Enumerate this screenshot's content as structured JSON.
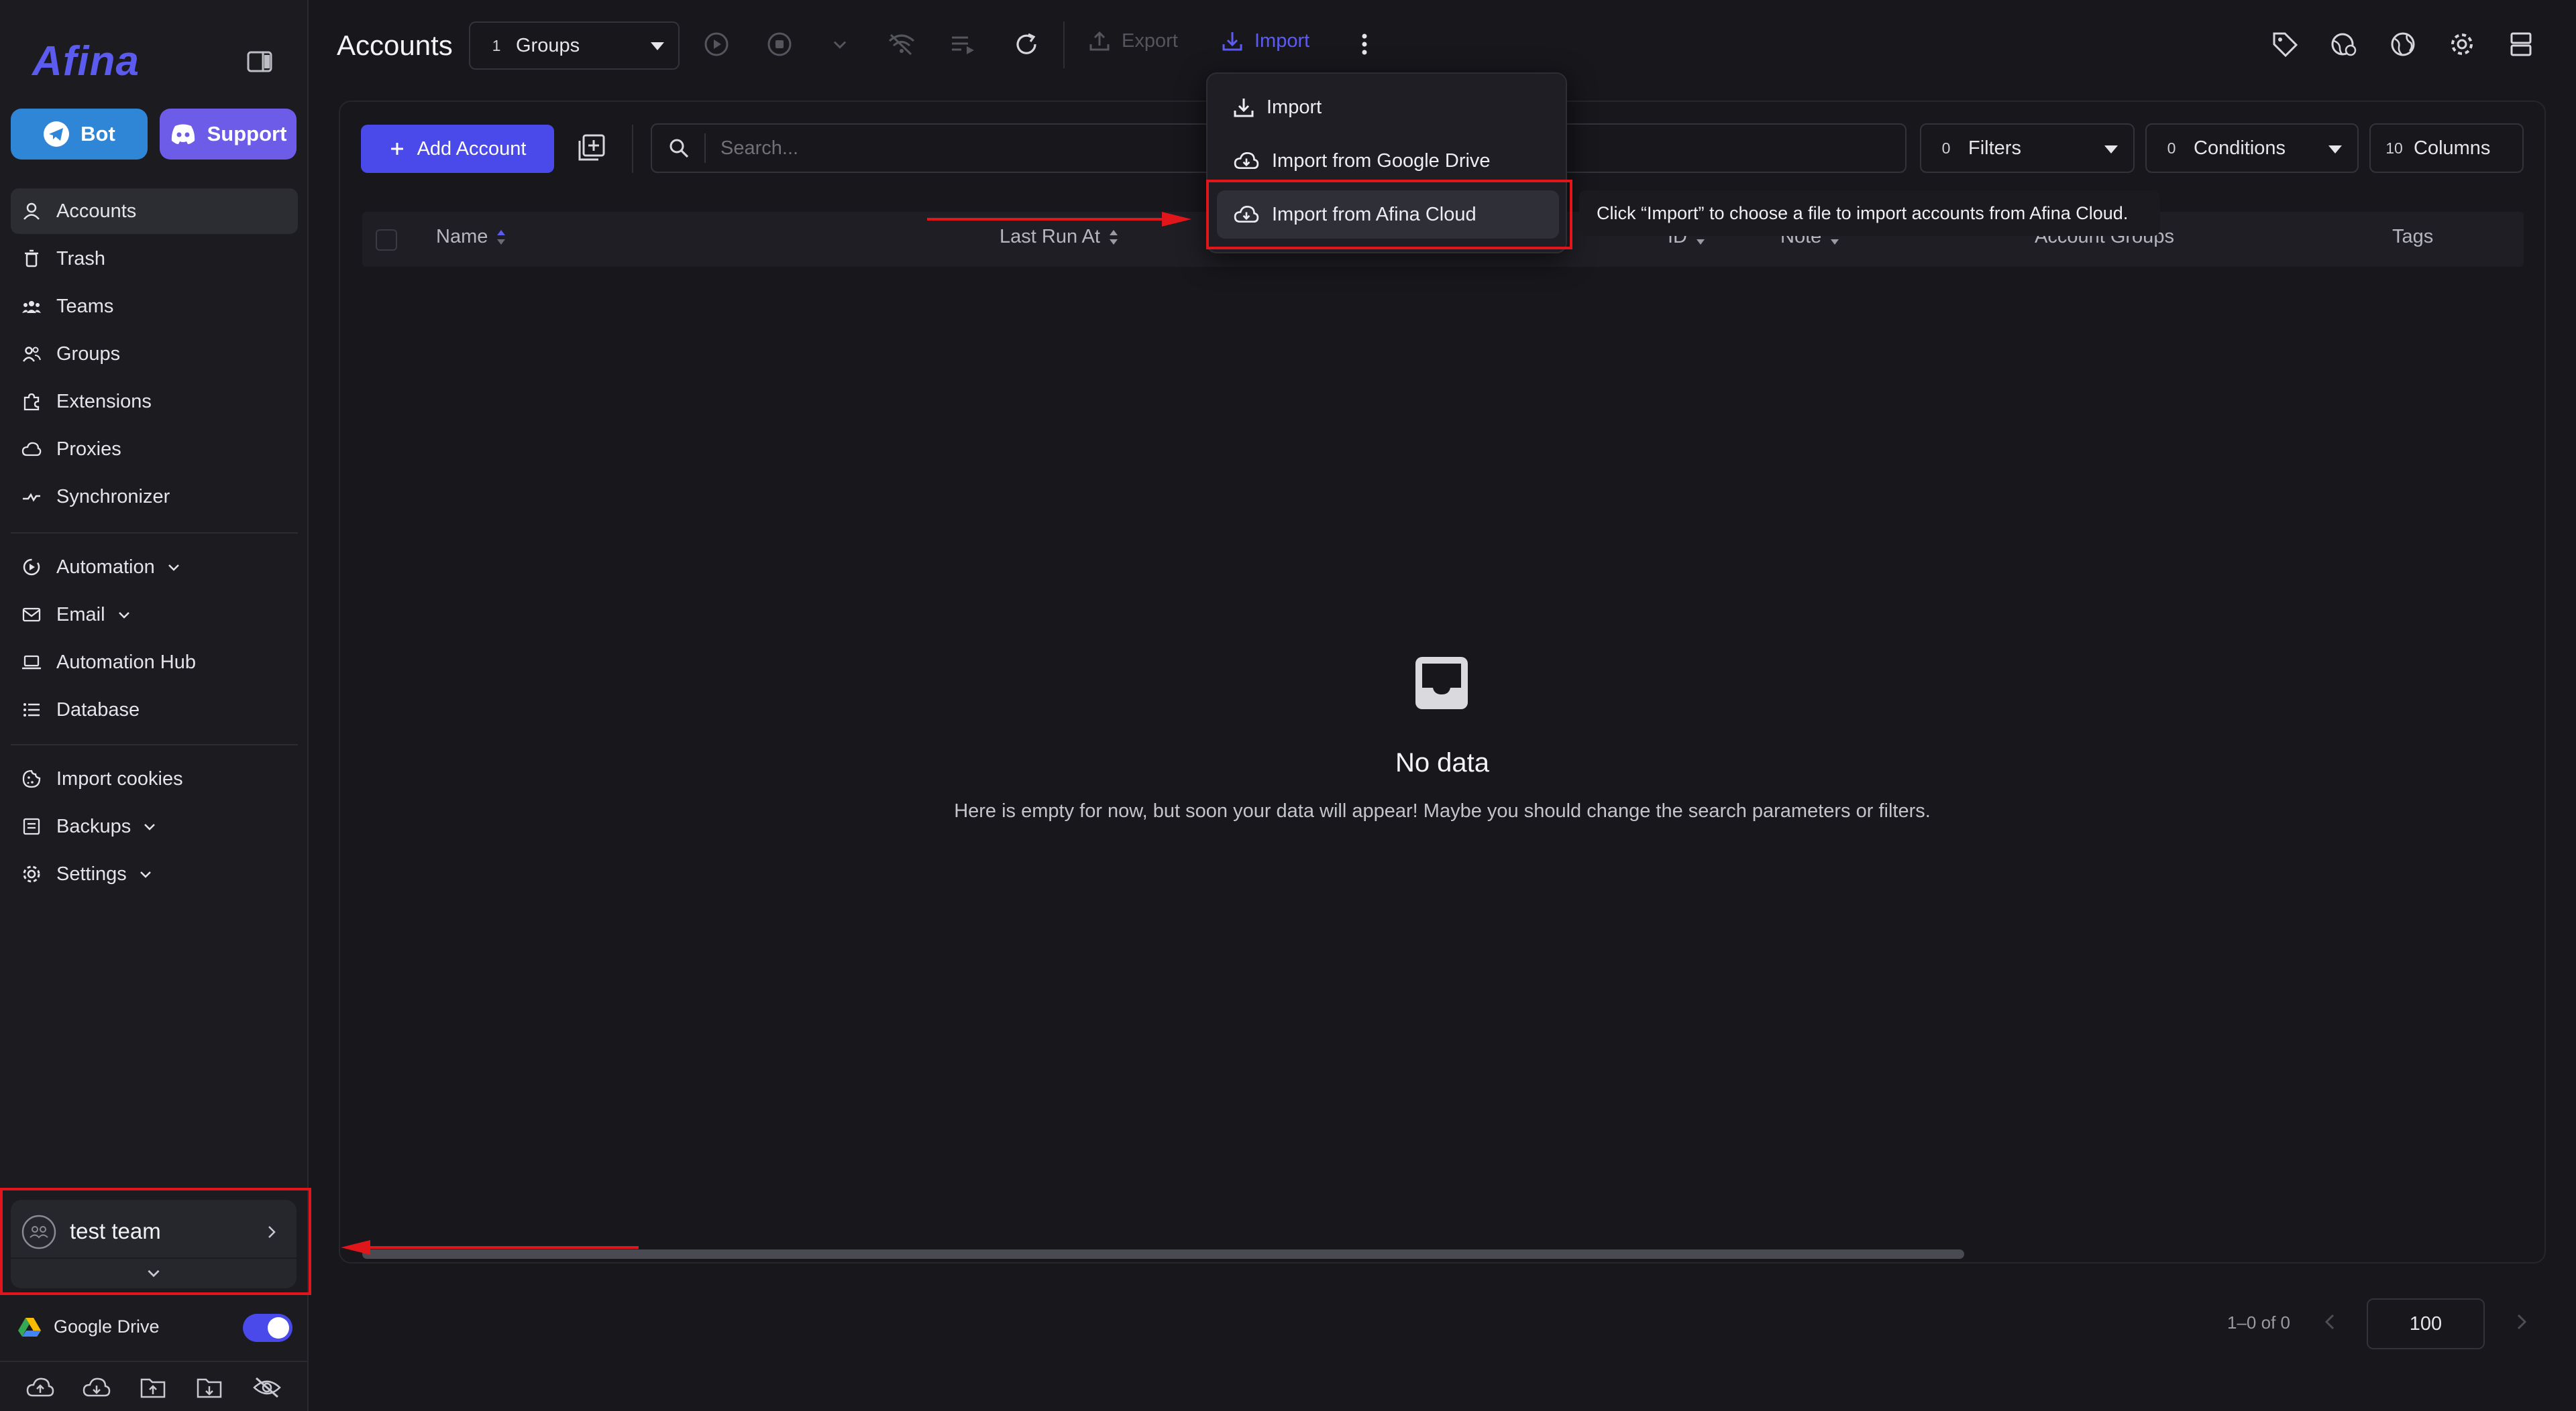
{
  "window": {
    "traffic_colors": [
      "#ff5f57",
      "#febc2e",
      "#28c840"
    ]
  },
  "sidebar": {
    "logo": "Afina",
    "bot_label": "Bot",
    "support_label": "Support",
    "nav": [
      {
        "label": "Accounts",
        "icon": "user-icon"
      },
      {
        "label": "Trash",
        "icon": "trash-icon"
      },
      {
        "label": "Teams",
        "icon": "teams-icon"
      },
      {
        "label": "Groups",
        "icon": "groups-icon"
      },
      {
        "label": "Extensions",
        "icon": "puzzle-icon"
      },
      {
        "label": "Proxies",
        "icon": "cloud-icon"
      },
      {
        "label": "Synchronizer",
        "icon": "sync-icon"
      },
      {
        "label": "Automation",
        "icon": "automation-icon"
      },
      {
        "label": "Email",
        "icon": "mail-icon"
      },
      {
        "label": "Automation Hub",
        "icon": "laptop-icon"
      },
      {
        "label": "Database",
        "icon": "list-icon"
      },
      {
        "label": "Import cookies",
        "icon": "cookie-icon"
      },
      {
        "label": "Backups",
        "icon": "backup-icon"
      },
      {
        "label": "Settings",
        "icon": "gear-icon"
      }
    ],
    "team_name": "test team",
    "google_drive_label": "Google Drive",
    "google_drive_enabled": true
  },
  "toolbar": {
    "title": "Accounts",
    "groups_count": "1",
    "groups_label": "Groups",
    "export_label": "Export",
    "import_label": "Import"
  },
  "import_menu": {
    "items": [
      "Import",
      "Import from Google Drive",
      "Import from Afina Cloud"
    ],
    "tooltip": "Click “Import” to choose a file to import accounts from Afina Cloud."
  },
  "controls": {
    "add_account_label": "Add Account",
    "search_placeholder": "Search...",
    "filters_count": "0",
    "filters_label": "Filters",
    "conditions_count": "0",
    "conditions_label": "Conditions",
    "columns_count": "10",
    "columns_label": "Columns"
  },
  "table": {
    "headers": [
      "Name",
      "Last Run At",
      "ID",
      "Note",
      "Account Groups",
      "Tags"
    ]
  },
  "empty_state": {
    "title": "No data",
    "message": "Here is empty for now, but soon your data will appear! Maybe you should change the search parameters or filters."
  },
  "pagination": {
    "range": "1–0 of 0",
    "page_size": "100"
  },
  "colors": {
    "accent": "#4a4aeb",
    "bot_button": "#2f86d6",
    "support_button": "#6c5ce7",
    "annotation_red": "#e0161b"
  }
}
